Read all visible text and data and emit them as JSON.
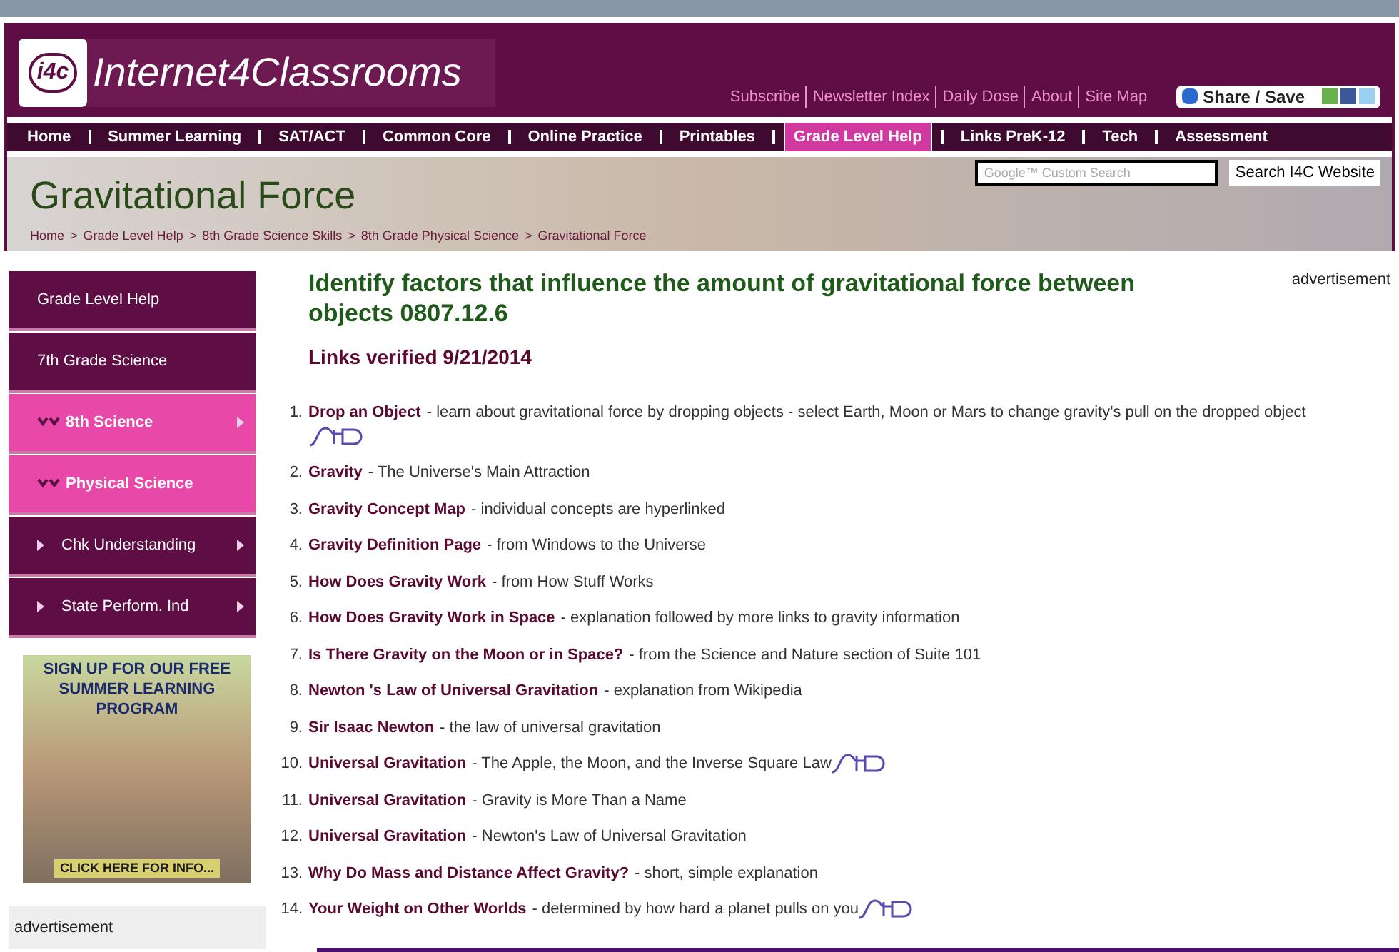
{
  "header": {
    "logo_mark": "i4c",
    "site_name": "Internet4Classrooms",
    "top_links": [
      "Subscribe",
      "Newsletter Index",
      "Daily Dose",
      "About",
      "Site Map"
    ],
    "share_button": "Share / Save"
  },
  "nav": [
    {
      "label": "Home",
      "selected": false
    },
    {
      "label": "Summer Learning",
      "selected": false
    },
    {
      "label": "SAT/ACT",
      "selected": false
    },
    {
      "label": "Common Core",
      "selected": false
    },
    {
      "label": "Online Practice",
      "selected": false
    },
    {
      "label": "Printables",
      "selected": false
    },
    {
      "label": "Grade Level Help",
      "selected": true
    },
    {
      "label": "Links PreK-12",
      "selected": false
    },
    {
      "label": "Tech",
      "selected": false
    },
    {
      "label": "Assessment",
      "selected": false
    }
  ],
  "banner": {
    "title": "Gravitational Force",
    "separator": ">",
    "breadcrumb": [
      "Home",
      "Grade Level Help",
      "8th Grade Science Skills",
      "8th Grade Physical Science",
      "Gravitational Force"
    ],
    "search": {
      "placeholder": "Google™ Custom Search",
      "button": "Search I4C Website"
    }
  },
  "sidebar": {
    "items": [
      {
        "label": "Grade Level Help",
        "kind": "top",
        "submenu": false
      },
      {
        "label": "7th Grade Science",
        "kind": "top",
        "submenu": false
      },
      {
        "label": "8th Science",
        "kind": "open",
        "submenu": true
      },
      {
        "label": "Physical Science",
        "kind": "open",
        "submenu": false
      },
      {
        "label": "Chk Understanding",
        "kind": "child",
        "submenu": true
      },
      {
        "label": "State Perform. Ind",
        "kind": "child",
        "submenu": true
      }
    ],
    "promo": {
      "headline": "SIGN UP FOR OUR FREE SUMMER LEARNING PROGRAM",
      "cta": "CLICK HERE FOR INFO..."
    },
    "ad_label": "advertisement"
  },
  "main": {
    "heading": "Identify factors that influence the amount of gravitational force between objects 0807.12.6",
    "verified": "Links verified 9/21/2014",
    "ad_label": "advertisement",
    "links": [
      {
        "number": "1.",
        "title": "Drop an Object",
        "description": "- learn about gravitational force by dropping objects - select Earth, Moon or Mars to change gravity's pull on the dropped object",
        "audio": true
      },
      {
        "number": "2.",
        "title": "Gravity",
        "description": "- The Universe's Main Attraction",
        "audio": false
      },
      {
        "number": "3.",
        "title": "Gravity Concept Map",
        "description": "- individual concepts are hyperlinked",
        "audio": false
      },
      {
        "number": "4.",
        "title": "Gravity Definition Page",
        "description": "- from Windows to the Universe",
        "audio": false
      },
      {
        "number": "5.",
        "title": "How Does Gravity Work",
        "description": "- from How Stuff Works",
        "audio": false
      },
      {
        "number": "6.",
        "title": "How Does Gravity Work in Space",
        "description": "- explanation followed by more links to gravity information",
        "audio": false
      },
      {
        "number": "7.",
        "title": "Is There Gravity on the Moon or in Space?",
        "description": "- from the Science and Nature section of Suite 101",
        "audio": false
      },
      {
        "number": "8.",
        "title": "Newton 's Law of Universal Gravitation",
        "description": "- explanation from Wikipedia",
        "audio": false
      },
      {
        "number": "9.",
        "title": "Sir Isaac Newton",
        "description": "- the law of universal gravitation",
        "audio": false
      },
      {
        "number": "10.",
        "title": "Universal Gravitation",
        "description": "- The Apple, the Moon, and the Inverse Square Law",
        "audio": true
      },
      {
        "number": "11.",
        "title": "Universal Gravitation",
        "description": "- Gravity is More Than a Name",
        "audio": false
      },
      {
        "number": "12.",
        "title": "Universal Gravitation",
        "description": "- Newton's Law of Universal Gravitation",
        "audio": false
      },
      {
        "number": "13.",
        "title": "Why Do Mass and Distance Affect Gravity?",
        "description": "- short, simple explanation",
        "audio": false
      },
      {
        "number": "14.",
        "title": "Your Weight on Other Worlds",
        "description": "- determined by how hard a planet pulls on you",
        "audio": true
      }
    ]
  }
}
